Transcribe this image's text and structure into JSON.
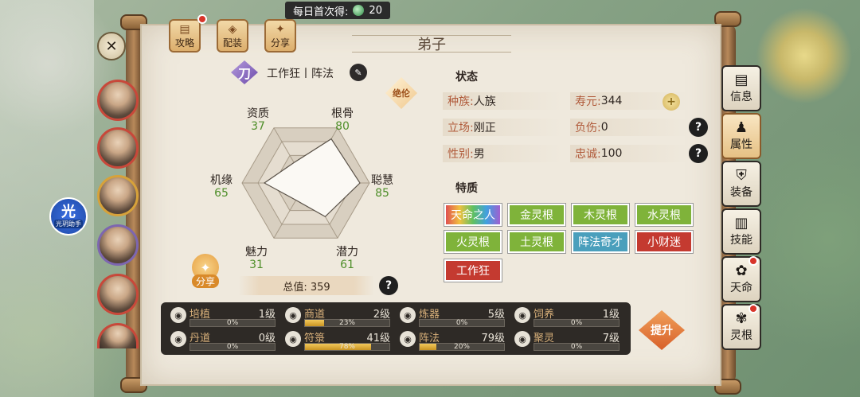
{
  "topbar": {
    "label": "每日首次得:",
    "amount": "20"
  },
  "toolbar": {
    "guide": "攻略",
    "equip": "配装",
    "share": "分享"
  },
  "page_title": "弟子",
  "helper": {
    "big": "光",
    "small": "光玥助手"
  },
  "role": {
    "glyph": "刀",
    "text": "工作狂丨阵法",
    "badge": "绝伦"
  },
  "aptitudes": [
    {
      "name": "资质",
      "value": "37"
    },
    {
      "name": "根骨",
      "value": "80"
    },
    {
      "name": "聪慧",
      "value": "85"
    },
    {
      "name": "潜力",
      "value": "61"
    },
    {
      "name": "魅力",
      "value": "31"
    },
    {
      "name": "机缘",
      "value": "65"
    }
  ],
  "radar_values": [
    37,
    80,
    85,
    61,
    31,
    65
  ],
  "total": "总值: 359",
  "share_left": "分享",
  "status": {
    "heading": "状态",
    "race_k": "种族:",
    "race_v": "人族",
    "stance_k": "立场:",
    "stance_v": "刚正",
    "gender_k": "性别:",
    "gender_v": "男",
    "life_k": "寿元:",
    "life_v": "344",
    "injury_k": "负伤:",
    "injury_v": "0",
    "loyal_k": "忠诚:",
    "loyal_v": "100"
  },
  "traits": {
    "heading": "特质",
    "items": [
      "天命之人",
      "金灵根",
      "木灵根",
      "水灵根",
      "火灵根",
      "土灵根",
      "阵法奇才",
      "小财迷",
      "工作狂"
    ]
  },
  "skills": [
    {
      "name": "培植",
      "level": "1级",
      "pct": "0%",
      "fill": 0,
      "icon": "sprout-icon"
    },
    {
      "name": "商道",
      "level": "2级",
      "pct": "23%",
      "fill": 0.23,
      "icon": "abacus-icon"
    },
    {
      "name": "炼器",
      "level": "5级",
      "pct": "0%",
      "fill": 0,
      "icon": "anvil-icon"
    },
    {
      "name": "饲养",
      "level": "1级",
      "pct": "0%",
      "fill": 0,
      "icon": "beast-icon"
    },
    {
      "name": "丹道",
      "level": "0级",
      "pct": "0%",
      "fill": 0,
      "icon": "cauldron-icon"
    },
    {
      "name": "符箓",
      "level": "41级",
      "pct": "78%",
      "fill": 0.78,
      "icon": "talisman-icon"
    },
    {
      "name": "阵法",
      "level": "79级",
      "pct": "20%",
      "fill": 0.2,
      "icon": "formation-icon"
    },
    {
      "name": "聚灵",
      "level": "7级",
      "pct": "0%",
      "fill": 0,
      "icon": "gather-icon"
    }
  ],
  "upgrade": "提升",
  "side_tabs": [
    "信息",
    "属性",
    "装备",
    "技能",
    "天命",
    "灵根"
  ]
}
